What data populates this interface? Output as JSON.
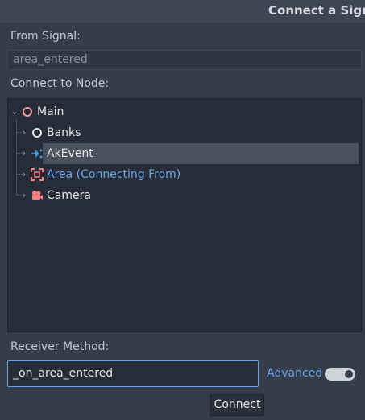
{
  "dialog": {
    "title": "Connect a Sign"
  },
  "from_signal": {
    "label": "From Signal:",
    "value": "area_entered"
  },
  "connect_to_node": {
    "label": "Connect to Node:",
    "tree": [
      {
        "label": "Main",
        "icon": "node-circle-icon",
        "color": "#f29e9e",
        "expanded": true,
        "level": 0
      },
      {
        "label": "Banks",
        "icon": "node-circle-icon",
        "color": "#e3e5e8",
        "expanded": false,
        "level": 1
      },
      {
        "label": "AkEvent",
        "icon": "akevent-icon",
        "color": "#3b9ad9",
        "expanded": false,
        "level": 1,
        "selected": true
      },
      {
        "label": "Area (Connecting From)",
        "icon": "area-icon",
        "color": "#fc7f7f",
        "expanded": false,
        "level": 1,
        "highlight": "#6aa5e6"
      },
      {
        "label": "Camera",
        "icon": "camera-icon",
        "color": "#fc7f7f",
        "expanded": false,
        "level": 1
      }
    ]
  },
  "receiver_method": {
    "label": "Receiver Method:",
    "value": "_on_area_entered"
  },
  "advanced": {
    "label": "Advanced",
    "enabled": true
  },
  "actions": {
    "connect_label": "Connect"
  },
  "colors": {
    "background": "#363d4a",
    "tree_background": "#262c38",
    "accent": "#6aa5e6",
    "selection": "#4a505c"
  }
}
